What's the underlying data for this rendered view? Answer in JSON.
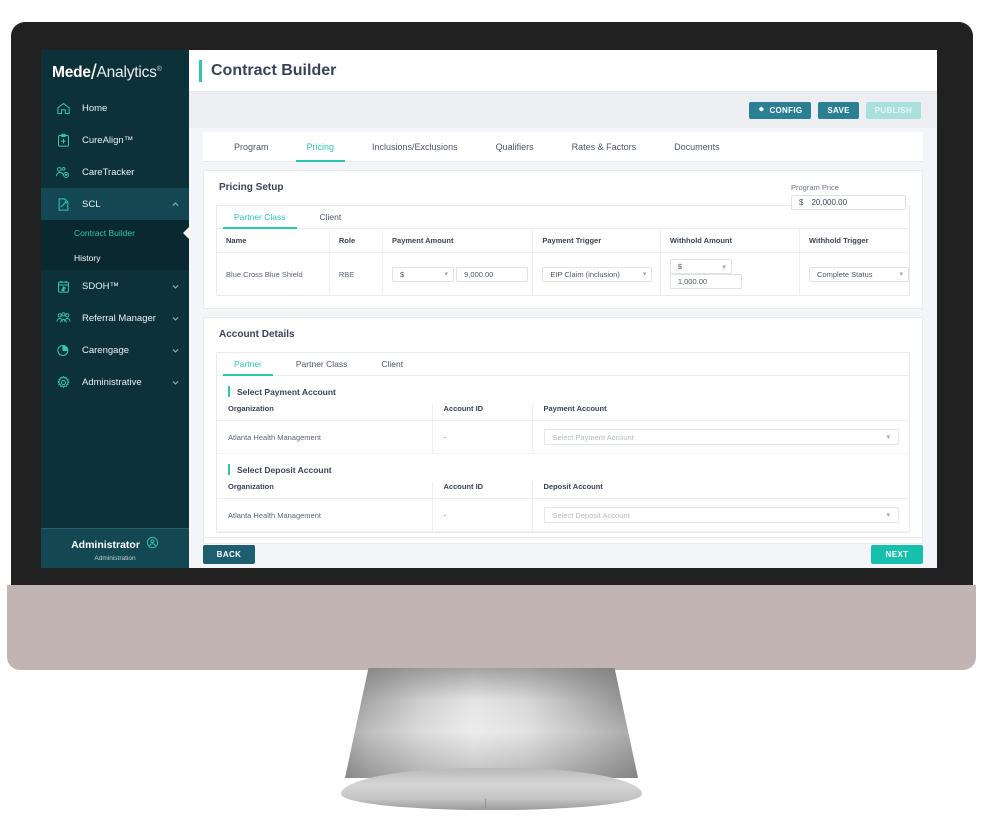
{
  "app": {
    "logo": {
      "part1": "Mede",
      "slash": "/",
      "part2": "Analytics",
      "tm": "®"
    },
    "page_title": "Contract Builder"
  },
  "sidebar": {
    "items": [
      {
        "label": "Home",
        "icon": "home-icon",
        "expandable": false
      },
      {
        "label": "CureAlign™",
        "icon": "clipboard-plus-icon",
        "expandable": false
      },
      {
        "label": "CareTracker",
        "icon": "people-gear-icon",
        "expandable": false
      },
      {
        "label": "SCL",
        "icon": "document-edit-icon",
        "expandable": true,
        "expanded": true
      },
      {
        "label": "SDOH™",
        "icon": "calendar-dollar-icon",
        "expandable": true
      },
      {
        "label": "Referral Manager",
        "icon": "group-icon",
        "expandable": true
      },
      {
        "label": "Carengage",
        "icon": "pie-chart-icon",
        "expandable": true
      },
      {
        "label": "Administrative",
        "icon": "gear-icon",
        "expandable": true
      }
    ],
    "subitems": [
      {
        "label": "Contract Builder",
        "active": true
      },
      {
        "label": "History",
        "active": false
      }
    ],
    "footer": {
      "name": "Administrator",
      "role": "Administration",
      "icon": "user-circle-icon"
    }
  },
  "toolbar": {
    "config_label": "CONFIG",
    "save_label": "SAVE",
    "publish_label": "PUBLISH"
  },
  "tabs": [
    {
      "label": "Program",
      "active": false
    },
    {
      "label": "Pricing",
      "active": true
    },
    {
      "label": "Inclusions/Exclusions",
      "active": false
    },
    {
      "label": "Qualifiers",
      "active": false
    },
    {
      "label": "Rates & Factors",
      "active": false
    },
    {
      "label": "Documents",
      "active": false
    }
  ],
  "pricing_setup": {
    "title": "Pricing Setup",
    "program_price": {
      "label": "Program Price",
      "currency": "$",
      "value": "20,000.00"
    },
    "tabs": [
      {
        "label": "Partner Class",
        "active": true
      },
      {
        "label": "Client",
        "active": false
      }
    ],
    "columns": [
      "Name",
      "Role",
      "Payment Amount",
      "Payment Trigger",
      "Withhold Amount",
      "Withhold Trigger"
    ],
    "rows": [
      {
        "name": "Blue Cross Blue Shield",
        "role": "RBE",
        "payment_currency": "$",
        "payment_amount": "9,000.00",
        "payment_trigger": "EIP Claim (inclusion)",
        "withhold_currency": "$",
        "withhold_amount": "1,000.00",
        "withhold_trigger": "Complete Status"
      }
    ]
  },
  "account_details": {
    "title": "Account Details",
    "tabs": [
      {
        "label": "Partner",
        "active": true
      },
      {
        "label": "Partner Class",
        "active": false
      },
      {
        "label": "Client",
        "active": false
      }
    ],
    "payment_section": {
      "heading": "Select Payment Account",
      "columns": [
        "Organization",
        "Account ID",
        "Payment Account"
      ],
      "rows": [
        {
          "organization": "Atlanta Health Management",
          "account_id": "-",
          "account_placeholder": "Select Payment Account"
        }
      ]
    },
    "deposit_section": {
      "heading": "Select Deposit Account",
      "columns": [
        "Organization",
        "Account ID",
        "Deposit Account"
      ],
      "rows": [
        {
          "organization": "Atlanta Health Management",
          "account_id": "-",
          "account_placeholder": "Select Deposit Account"
        }
      ]
    }
  },
  "footer_nav": {
    "back_label": "BACK",
    "next_label": "NEXT"
  },
  "colors": {
    "accent_teal": "#2ec6b0",
    "sidebar_bg": "#0d3139",
    "sidebar_active": "#0a2830",
    "button_blue": "#2a7f93",
    "next_teal": "#17c0ad",
    "publish_disabled": "#a9e0dc",
    "monitor_bezel": "#212121",
    "monitor_chin": "#c2b4b2"
  }
}
